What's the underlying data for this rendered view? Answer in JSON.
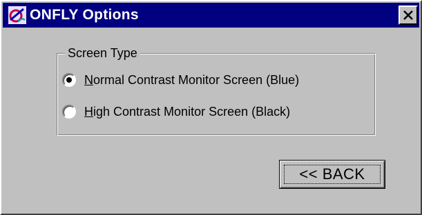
{
  "window": {
    "title": "ONFLY Options",
    "titlebar_color": "#000080",
    "icon": "onfly-app-icon",
    "close_icon": "close-x-icon"
  },
  "screen_type": {
    "legend": "Screen Type",
    "options": [
      {
        "mnemonic": "N",
        "rest": "ormal Contrast Monitor Screen (Blue)",
        "selected": true
      },
      {
        "mnemonic": "H",
        "rest": "igh Contrast Monitor Screen (Black)",
        "selected": false
      }
    ]
  },
  "back_button": {
    "label": "<< BACK"
  }
}
